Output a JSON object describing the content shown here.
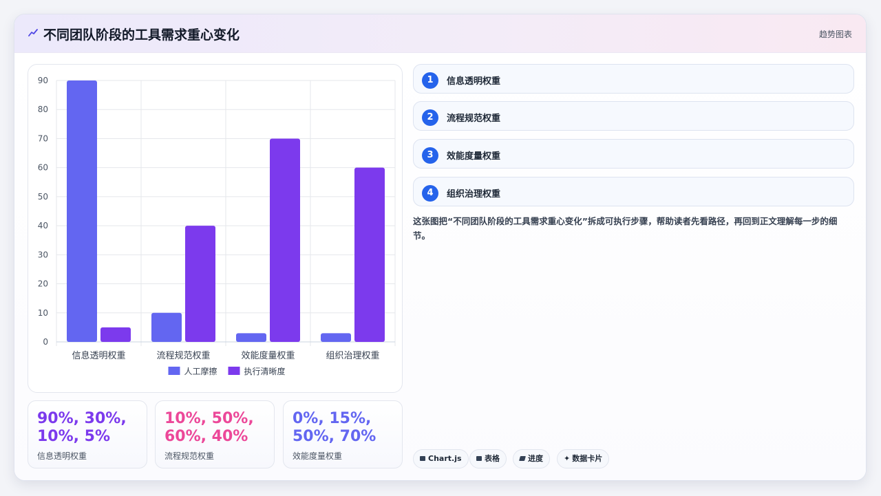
{
  "header": {
    "title": "不同团队阶段的工具需求重心变化",
    "tag": "趋势图表",
    "icon": "trend-line-icon"
  },
  "chart_data": {
    "type": "bar",
    "categories": [
      "信息透明权重",
      "流程规范权重",
      "效能度量权重",
      "组织治理权重"
    ],
    "series": [
      {
        "name": "人工摩擦",
        "values": [
          90,
          10,
          3,
          3
        ],
        "color": "#6366f1"
      },
      {
        "name": "执行清晰度",
        "values": [
          5,
          40,
          70,
          60
        ],
        "color": "#7c3aed"
      }
    ],
    "ylim": [
      0,
      90
    ],
    "yticks": [
      0,
      10,
      20,
      30,
      40,
      50,
      60,
      70,
      80,
      90
    ],
    "grid": true,
    "legend": "bottom",
    "xlabel": "",
    "ylabel": ""
  },
  "stats": [
    {
      "value": "90%, 30%, 10%, 5%",
      "label": "信息透明权重",
      "color": "#7c3aed"
    },
    {
      "value": "10%, 50%, 60%, 40%",
      "label": "流程规范权重",
      "color": "#ec4899"
    },
    {
      "value": "0%, 15%, 50%, 70%",
      "label": "效能度量权重",
      "color": "#6366f1"
    }
  ],
  "steps": [
    {
      "num": "1",
      "label": "信息透明权重"
    },
    {
      "num": "2",
      "label": "流程规范权重"
    },
    {
      "num": "3",
      "label": "效能度量权重"
    },
    {
      "num": "4",
      "label": "组织治理权重"
    }
  ],
  "description": "这张图把“不同团队阶段的工具需求重心变化”拆成可执行步骤，帮助读者先看路径，再回到正文理解每一步的细节。",
  "chips": [
    {
      "label": "Chart.js",
      "icon": "chart-icon"
    },
    {
      "label": "表格",
      "icon": "table-icon"
    },
    {
      "label": "进度",
      "icon": "progress-icon"
    },
    {
      "label": "数据卡片",
      "icon": "sparkle-icon"
    }
  ]
}
